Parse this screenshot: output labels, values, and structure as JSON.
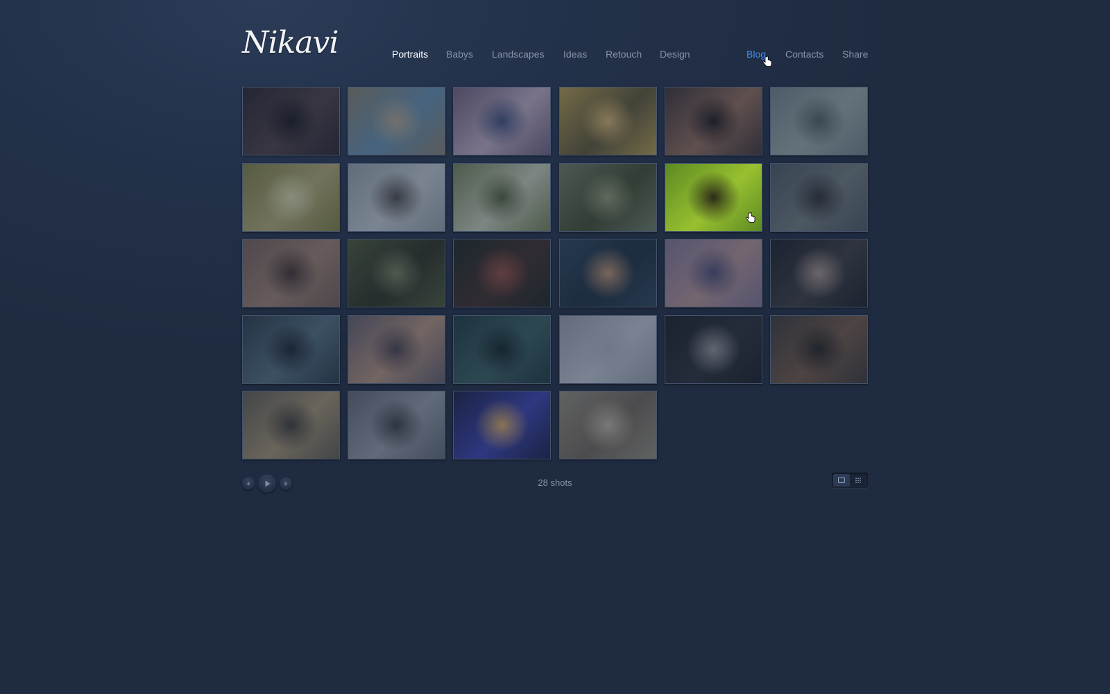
{
  "brand": {
    "logo": "Nikavi"
  },
  "nav": {
    "items": [
      {
        "label": "Portraits",
        "state": "active"
      },
      {
        "label": "Babys",
        "state": "normal"
      },
      {
        "label": "Landscapes",
        "state": "normal"
      },
      {
        "label": "Ideas",
        "state": "normal"
      },
      {
        "label": "Retouch",
        "state": "normal"
      },
      {
        "label": "Design",
        "state": "normal"
      },
      {
        "label": "Blog",
        "state": "hover"
      },
      {
        "label": "Contacts",
        "state": "normal"
      },
      {
        "label": "Share",
        "state": "normal"
      }
    ]
  },
  "gallery": {
    "count_label": "28 shots",
    "hovered_index": 10,
    "thumbnails": [
      {
        "name": "man-smoking-doorway",
        "palette": [
          "#2a2430",
          "#4a3e44",
          "#1a1820"
        ]
      },
      {
        "name": "man-lying-on-branches",
        "palette": [
          "#7f7a6c",
          "#5f88a8",
          "#a89c88"
        ]
      },
      {
        "name": "woman-mirror-reflection",
        "palette": [
          "#6a5b78",
          "#b2a2b8",
          "#3e4a74"
        ]
      },
      {
        "name": "woman-wide-hat-sand",
        "palette": [
          "#a8924e",
          "#5a5234",
          "#c8aa6a"
        ]
      },
      {
        "name": "woman-black-hat",
        "palette": [
          "#3c3236",
          "#8a6858",
          "#1e1a1e"
        ]
      },
      {
        "name": "blonde-woman-ferns",
        "palette": [
          "#6b7a80",
          "#8fa0a0",
          "#4c5a5c"
        ]
      },
      {
        "name": "woman-white-headscarf",
        "palette": [
          "#7a7a40",
          "#a8a070",
          "#c8c8a0"
        ]
      },
      {
        "name": "woman-brunette-white-wall",
        "palette": [
          "#8c96a0",
          "#b4bcc4",
          "#4a4848"
        ]
      },
      {
        "name": "woman-white-dress-flowers",
        "palette": [
          "#6c7a54",
          "#b8beac",
          "#4e5a3a"
        ]
      },
      {
        "name": "girl-sitting-in-field",
        "palette": [
          "#6a7660",
          "#3e4a30",
          "#8c9070"
        ]
      },
      {
        "name": "girl-green-leaves",
        "palette": [
          "#5c8a22",
          "#98c030",
          "#2a2a18"
        ]
      },
      {
        "name": "woman-grey-fedora",
        "palette": [
          "#4a5460",
          "#6a7478",
          "#2c2e34"
        ]
      },
      {
        "name": "woman-rusty-wall",
        "palette": [
          "#6e5a54",
          "#947a6c",
          "#3e3030"
        ]
      },
      {
        "name": "woman-mossy-rocks",
        "palette": [
          "#4a5438",
          "#2c3024",
          "#6e7858"
        ]
      },
      {
        "name": "woman-red-dress-night",
        "palette": [
          "#1e2624",
          "#3e2e2c",
          "#8a4a40"
        ]
      },
      {
        "name": "woman-short-hair-studio",
        "palette": [
          "#2c4258",
          "#1e2e40",
          "#b08a6c"
        ]
      },
      {
        "name": "woman-braided-hair-closeup",
        "palette": [
          "#7a6e90",
          "#a88a8c",
          "#4a4870"
        ]
      },
      {
        "name": "woman-smoking-dark",
        "palette": [
          "#1c2028",
          "#3a3a40",
          "#9c8c84"
        ]
      },
      {
        "name": "three-women-dark",
        "palette": [
          "#2a3a48",
          "#50687a",
          "#1a242e"
        ]
      },
      {
        "name": "blonde-woman-pink-backdrop",
        "palette": [
          "#5e5866",
          "#a88a78",
          "#463e4c"
        ]
      },
      {
        "name": "woman-pixie-cut-teal",
        "palette": [
          "#1e3a40",
          "#385a5e",
          "#142428"
        ]
      },
      {
        "name": "woman-white-scarf-sitting",
        "palette": [
          "#8c94a0",
          "#b4bac4",
          "#a0a8b4"
        ]
      },
      {
        "name": "man-sunglasses-dark",
        "palette": [
          "#1a1e26",
          "#2a2e38",
          "#8c8c92"
        ]
      },
      {
        "name": "woman-curly-hair-portrait",
        "palette": [
          "#3a3838",
          "#6c5446",
          "#242222"
        ]
      },
      {
        "name": "blonde-woman-looking-up",
        "palette": [
          "#5a564e",
          "#9a8a6c",
          "#3a3834"
        ]
      },
      {
        "name": "man-snow-jacket",
        "palette": [
          "#5a626e",
          "#8a929c",
          "#363c44"
        ]
      },
      {
        "name": "man-bokeh-lights",
        "palette": [
          "#1a2048",
          "#3a40a8",
          "#c8a060"
        ]
      },
      {
        "name": "woman-closeup-beige",
        "palette": [
          "#8a8478",
          "#6a6258",
          "#b0a898"
        ]
      }
    ]
  },
  "controls": {
    "prev_icon": "triangle-left-icon",
    "play_icon": "play-icon",
    "next_icon": "triangle-right-icon",
    "view_single_icon": "single-view-icon",
    "view_grid_icon": "grid-view-icon",
    "active_view": "single"
  },
  "colors": {
    "background": "#23314a",
    "nav_text": "#8693a8",
    "nav_active": "#ffffff",
    "nav_hover": "#3f8ff0"
  }
}
